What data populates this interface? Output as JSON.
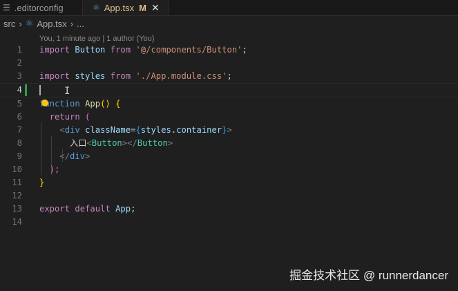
{
  "tabs": [
    {
      "label": ".editorconfig",
      "icon": "lines-icon"
    },
    {
      "label": "App.tsx",
      "badge": "M",
      "icon": "react-icon",
      "active": true
    }
  ],
  "breadcrumb": [
    "src",
    "App.tsx",
    "..."
  ],
  "blame": "You, 1 minute ago | 1 author (You)",
  "line_numbers": [
    "1",
    "2",
    "3",
    "4",
    "5",
    "6",
    "7",
    "8",
    "9",
    "10",
    "11",
    "12",
    "13",
    "14"
  ],
  "code": {
    "l1": [
      "import",
      " Button",
      " from",
      " '@/components/Button'",
      ";"
    ],
    "l3": [
      "import",
      " styles",
      " from",
      " './App.module.css'",
      ";"
    ],
    "l5": [
      "function",
      " App",
      "()",
      " {"
    ],
    "l6": [
      "return",
      " ("
    ],
    "l7": [
      "<",
      "div",
      " className",
      "=",
      "{",
      "styles",
      ".",
      "container",
      "}",
      ">"
    ],
    "l8": [
      "入口",
      "<",
      "Button",
      "></",
      "Button",
      ">"
    ],
    "l9": [
      "</",
      "div",
      ">"
    ],
    "l10": [
      ");"
    ],
    "l11": [
      "}"
    ],
    "l13": [
      "export",
      " default",
      " App",
      ";"
    ]
  },
  "watermark": "掘金技术社区 @ runnerdancer"
}
